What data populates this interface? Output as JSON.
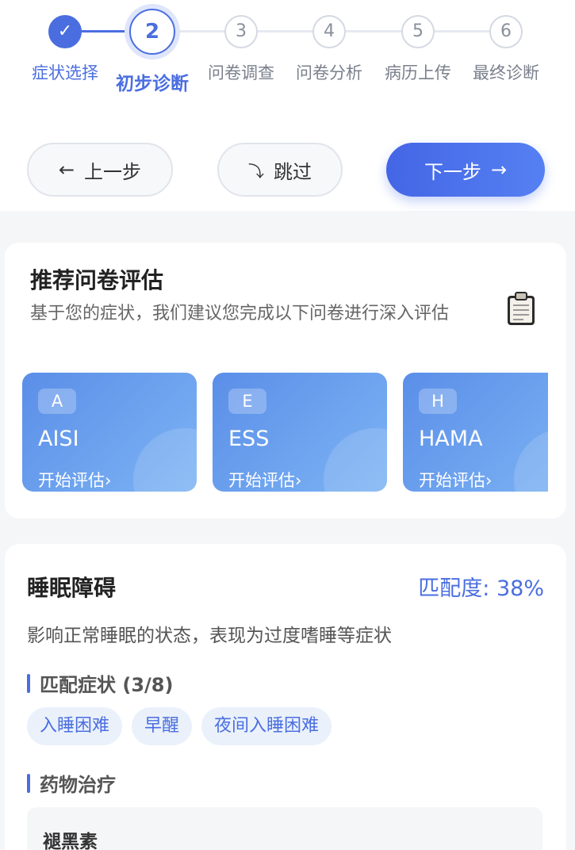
{
  "steps": [
    {
      "num": "✓",
      "label": "症状选择",
      "state": "done"
    },
    {
      "num": "2",
      "label": "初步诊断",
      "state": "active"
    },
    {
      "num": "3",
      "label": "问卷调查",
      "state": "todo"
    },
    {
      "num": "4",
      "label": "问卷分析",
      "state": "todo"
    },
    {
      "num": "5",
      "label": "病历上传",
      "state": "todo"
    },
    {
      "num": "6",
      "label": "最终诊断",
      "state": "todo"
    }
  ],
  "nav": {
    "prev": {
      "icon": "←",
      "label": "上一步"
    },
    "skip": {
      "icon": "⤵",
      "label": "跳过"
    },
    "next": {
      "icon": "→",
      "label": "下一步"
    }
  },
  "questionnaire": {
    "title": "推荐问卷评估",
    "description": "基于您的症状，我们建议您完成以下问卷进行深入评估",
    "icon": "clipboard-icon",
    "items": [
      {
        "badge": "A",
        "name": "AISI",
        "action": "开始评估",
        "arrow": "›"
      },
      {
        "badge": "E",
        "name": "ESS",
        "action": "开始评估",
        "arrow": "›"
      },
      {
        "badge": "H",
        "name": "HAMA",
        "action": "开始评估",
        "arrow": "›"
      }
    ]
  },
  "diagnosis": {
    "title": "睡眠障碍",
    "match": "匹配度: 38%",
    "description": "影响正常睡眠的状态，表现为过度嗜睡等症状",
    "symptoms_title": "匹配症状 (3/8)",
    "symptoms": [
      "入睡困难",
      "早醒",
      "夜间入睡困难"
    ],
    "drugs_title": "药物治疗",
    "drugs": [
      "褪黑素"
    ]
  },
  "colors": {
    "accent": "#4a6ee0",
    "card_gradient_start": "#5b8ee8",
    "card_gradient_end": "#7db4f4"
  }
}
